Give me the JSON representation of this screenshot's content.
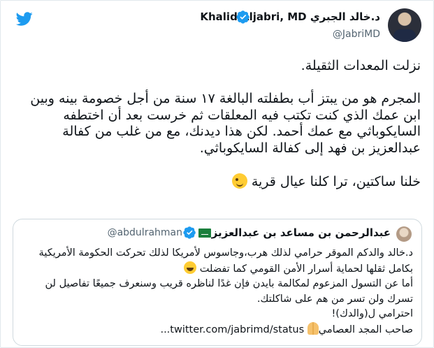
{
  "colors": {
    "twitter_blue": "#1d9bf0",
    "text": "#0f1419",
    "secondary_text": "#536471",
    "border": "#cfd9de"
  },
  "icons": {
    "brand": "twitter-bird-icon",
    "verified": "verified-badge-icon"
  },
  "tweet": {
    "display_name": "د.خالد الجبري Khalid Aljabri, MD",
    "handle": "@JabriMD",
    "text": "نزلت المعدات الثقيلة.\n\nالمجرم هو من يبتز أب بطفلته البالغة ١٧ سنة من أجل خصومة بينه وبين ابن عمك الذي كنت تكتب فيه المعلقات ثم خرست بعد أن اختطفه السايكوباثي مع عمك أحمد. لكن هذا ديدنك، مع من غلب من كفالة عبدالعزيز بن فهد إلى كفالة السايكوباثي.\n\nخلنا ساكتين، ترا كلنا عيال قرية",
    "emoji": "winking-face"
  },
  "quoted_tweet": {
    "display_name": "عبدالرحمن بن مساعد بن عبدالعزيز",
    "flag": "saudi-flag",
    "handle": "@abdulrahman",
    "text_line1": "د.خالد والدكم الموقر حرامي لذلك هرب،وجاسوس لأمريكا لذلك تحركت الحكومة الأمريكية بكامل ثقلها لحماية أسرار الأمن القومي كما تفضلت",
    "text_line2": "أما عن التسول المزعوم لمكالمة بايدن فإن غدًا لناظره قريب وسنعرف جميعًا تفاصيل لن تسرك ولن تسر من هم على شاكلتك.\nاحترامي ل(والدك)!",
    "text_line3": "صاحب المجد العصامي",
    "link": "twitter.com/jabrimd/status...",
    "emoji_1": "grinning-face",
    "emoji_2": "folded-hands"
  }
}
